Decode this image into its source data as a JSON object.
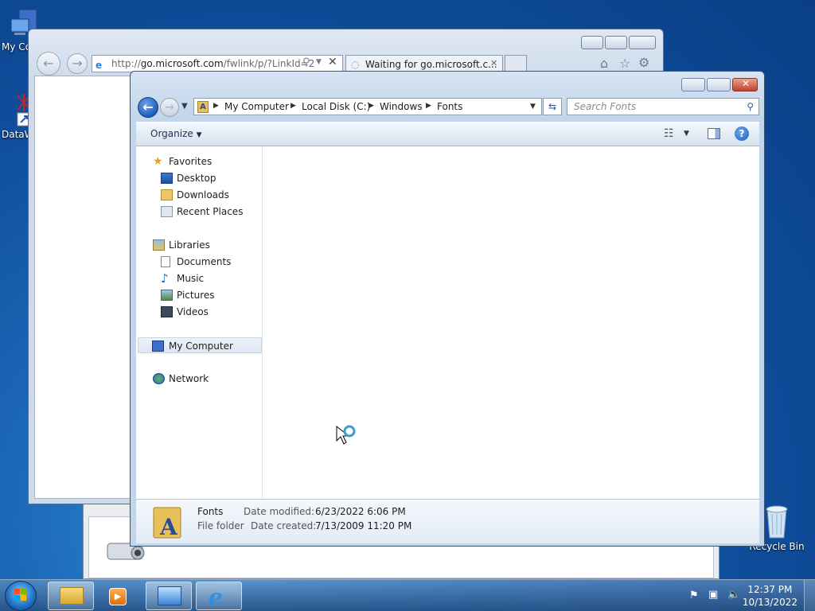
{
  "desktop": {
    "icons": [
      {
        "label": "My Co"
      },
      {
        "label": "DataW"
      },
      {
        "label": "Recycle Bin"
      }
    ]
  },
  "ie": {
    "address": "http://go.microsoft.com/fwlink/p/?LinkId=2",
    "address_host": "go.microsoft.com",
    "address_prefix": "http://",
    "address_suffix": "/fwlink/p/?LinkId=2",
    "tab_label": "Waiting for go.microsoft.c..."
  },
  "explorer": {
    "breadcrumbs": [
      "My Computer",
      "Local Disk (C:)",
      "Windows",
      "Fonts"
    ],
    "search_placeholder": "Search Fonts",
    "toolbar": {
      "organize": "Organize"
    },
    "nav": {
      "favorites": "Favorites",
      "desktop": "Desktop",
      "downloads": "Downloads",
      "recent_places": "Recent Places",
      "libraries": "Libraries",
      "documents": "Documents",
      "music": "Music",
      "pictures": "Pictures",
      "videos": "Videos",
      "my_computer": "My Computer",
      "network": "Network"
    },
    "details": {
      "name": "Fonts",
      "type": "File folder",
      "date_modified_label": "Date modified:",
      "date_modified": "6/23/2022 6:06 PM",
      "date_created_label": "Date created:",
      "date_created": "7/13/2009 11:20 PM"
    }
  },
  "taskbar": {
    "time": "12:37 PM",
    "date": "10/13/2022"
  },
  "colors": {
    "accent": "#1f5fbb",
    "close_button": "#c4402a",
    "desktop_blue": "#0f4e9c"
  }
}
